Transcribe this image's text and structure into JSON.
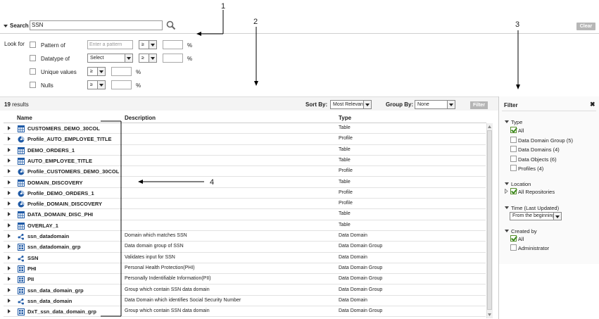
{
  "search": {
    "label": "Search",
    "value": "SSN",
    "clear_label": "Clear"
  },
  "look_for": {
    "label": "Look for",
    "criteria": [
      {
        "label": "Pattern of",
        "placeholder": "Enter a pattern",
        "operator": "≥",
        "unit": "%"
      },
      {
        "label": "Datatype of",
        "select": "Select",
        "operator": "≥",
        "unit": "%"
      },
      {
        "label": "Unique values",
        "operator": "≥",
        "unit": "%"
      },
      {
        "label": "Nulls",
        "operator": "≥",
        "unit": "%"
      }
    ]
  },
  "results": {
    "count": "19",
    "count_suffix": "results",
    "sort_label": "Sort By:",
    "sort_value": "Most Relevant",
    "group_label": "Group By:",
    "group_value": "None",
    "filter_label": "Filter"
  },
  "table": {
    "headers": {
      "name": "Name",
      "description": "Description",
      "type": "Type"
    },
    "rows": [
      {
        "icon": "table-icon",
        "name": "CUSTOMERS_DEMO_30COL",
        "description": "",
        "type": "Table"
      },
      {
        "icon": "profile-icon",
        "name": "Profile_AUTO_EMPLOYEE_TITLE",
        "description": "",
        "type": "Profile"
      },
      {
        "icon": "table-icon",
        "name": "DEMO_ORDERS_1",
        "description": "",
        "type": "Table"
      },
      {
        "icon": "table-icon",
        "name": "AUTO_EMPLOYEE_TITLE",
        "description": "",
        "type": "Table"
      },
      {
        "icon": "profile-icon",
        "name": "Profile_CUSTOMERS_DEMO_30COL",
        "description": "",
        "type": "Profile"
      },
      {
        "icon": "table-icon",
        "name": "DOMAIN_DISCOVERY",
        "description": "",
        "type": "Table"
      },
      {
        "icon": "profile-icon",
        "name": "Profile_DEMO_ORDERS_1",
        "description": "",
        "type": "Profile"
      },
      {
        "icon": "profile-icon",
        "name": "Profile_DOMAIN_DISCOVERY",
        "description": "",
        "type": "Profile"
      },
      {
        "icon": "table-icon",
        "name": "DATA_DOMAIN_DISC_PHI",
        "description": "",
        "type": "Table"
      },
      {
        "icon": "table-icon",
        "name": "OVERLAY_1",
        "description": "",
        "type": "Table"
      },
      {
        "icon": "data-domain-icon",
        "name": "ssn_datadomain",
        "description": "Domain which matches SSN",
        "type": "Data Domain"
      },
      {
        "icon": "data-domain-group-icon",
        "name": "ssn_datadomain_grp",
        "description": "Data domain group of SSN",
        "type": "Data Domain Group"
      },
      {
        "icon": "data-domain-icon",
        "name": "SSN",
        "description": "Validates input for SSN",
        "type": "Data Domain"
      },
      {
        "icon": "data-domain-group-icon",
        "name": "PHI",
        "description": "Personal Health Protection(PHI)",
        "type": "Data Domain Group"
      },
      {
        "icon": "data-domain-group-icon",
        "name": "PII",
        "description": "Personally Indentifiable Information(PII)",
        "type": "Data Domain Group"
      },
      {
        "icon": "data-domain-group-icon",
        "name": "ssn_data_domain_grp",
        "description": "Group which contain SSN data domain",
        "type": "Data Domain Group"
      },
      {
        "icon": "data-domain-icon",
        "name": "ssn_data_domain",
        "description": "Data Domain which identifies Social Security Number",
        "type": "Data Domain"
      },
      {
        "icon": "data-domain-group-icon",
        "name": "DxT_ssn_data_domain_grp",
        "description": "Group which contain SSN data domain",
        "type": "Data Domain Group"
      }
    ]
  },
  "filter_panel": {
    "title": "Filter",
    "close": "✖",
    "type_section": "Type",
    "type_options": [
      {
        "label": "All",
        "checked": true
      },
      {
        "label": "Data Domain Group (5)",
        "checked": false
      },
      {
        "label": "Data Domains (4)",
        "checked": false
      },
      {
        "label": "Data Objects (6)",
        "checked": false
      },
      {
        "label": "Profiles (4)",
        "checked": false
      }
    ],
    "location_section": "Location",
    "location_option": "All Repositories",
    "time_section": "Time (Last Updated)",
    "time_value": "From the beginning",
    "created_section": "Created by",
    "created_options": [
      {
        "label": "All",
        "checked": true
      },
      {
        "label": "Administrator",
        "checked": false
      }
    ]
  },
  "callouts": [
    "1",
    "2",
    "3",
    "4"
  ],
  "colors": {
    "accent_blue": "#1f5aa6",
    "check_green": "#3c8a1e",
    "button_gray": "#b5b5b5"
  }
}
